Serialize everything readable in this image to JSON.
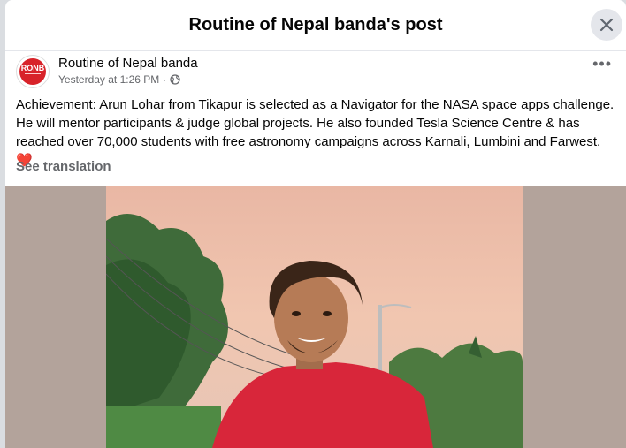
{
  "dialog": {
    "title": "Routine of Nepal banda's post",
    "close_icon": "close-icon"
  },
  "post": {
    "author": "Routine of Nepal banda",
    "avatar_text": "RONB",
    "timestamp": "Yesterday at 1:26 PM",
    "separator": "·",
    "audience_icon": "globe-icon",
    "more_icon": "more-options-icon",
    "text": "Achievement: Arun Lohar from Tikapur is selected as a Navigator for the NASA space apps challenge. He will mentor participants & judge global projects.  He also founded Tesla Science Centre & has reached over 70,000 students with free astronomy campaigns across Karnali, Lumbini and Farwest.",
    "heart": "❤️",
    "see_translation": "See translation"
  },
  "colors": {
    "brand_red": "#d8232a",
    "secondary_text": "#65676b",
    "close_bg": "#e4e6eb"
  }
}
